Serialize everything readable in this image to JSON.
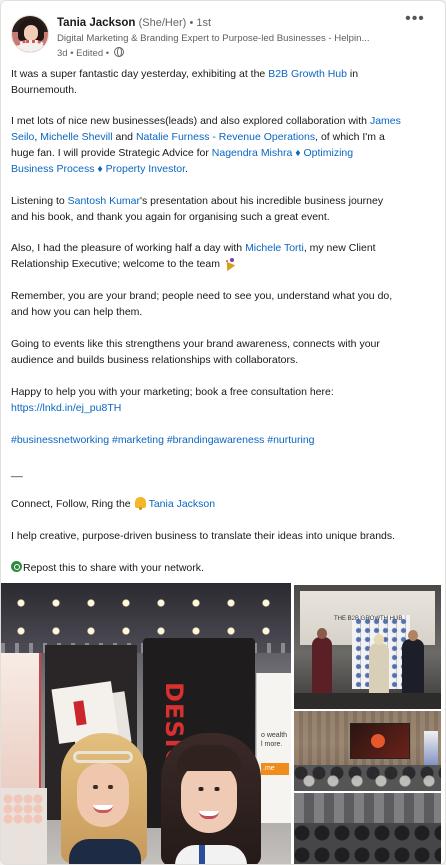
{
  "post": {
    "author": {
      "name": "Tania Jackson",
      "pronouns": "(She/Her)",
      "degree": "• 1st",
      "headline": "Digital Marketing & Branding Expert to Purpose-led Businesses - Helpin...",
      "meta": "3d • Edited •",
      "avatar_icon": "profile-photo"
    },
    "more_label": "•••",
    "lines": {
      "l1a": "It was a super fantastic day yesterday, exhibiting at the ",
      "l1b": "B2B Growth Hub",
      "l1c": " in",
      "l2": "Bournemouth.",
      "l3a": "I met lots of nice new businesses(leads) and also explored collaboration with ",
      "l3b": "James",
      "l4a": "Seilo",
      "l4b": ", ",
      "l4c": "Michelle Shevill",
      "l4d": " and ",
      "l4e": "Natalie Furness - Revenue Operations",
      "l4f": ", of which I'm a",
      "l5a": "huge fan. I will provide Strategic Advice for ",
      "l5b": "Nagendra Mishra ♦ Optimizing",
      "l6a": "Business Process ♦ Property Investor",
      "l6b": ".",
      "l7a": "Listening to ",
      "l7b": "Santosh Kumar",
      "l7c": "'s presentation about his incredible business journey",
      "l8": "and his book, and thank you again for organising such a great event.",
      "l9a": "Also, I had the pleasure of working half a day with ",
      "l9b": "Michele Torti",
      "l9c": ", my new Client",
      "l10": "Relationship Executive; welcome to the team ",
      "l11": "Remember, you are your brand; people need to see you, understand what you do,",
      "l12": "and how you can help them.",
      "l13": "Going to events like this strengthens your brand awareness, connects with your",
      "l14": "audience and builds business relationships with collaborators.",
      "l15": "Happy to help you with your marketing; book a free consultation here:",
      "l16": "https://lnkd.in/ej_pu8TH",
      "l17": "#businessnetworking #marketing #brandingawareness #nurturing",
      "l18": "__",
      "l19a": "Connect, Follow, Ring the ",
      "l19b": "Tania Jackson",
      "l20": "I help creative, purpose-driven business to translate their ideas into unique brands.",
      "l21": "Repost this to share with your network."
    },
    "photos": {
      "main_banner_text": "DESIGN",
      "side_board_text": "o wealth\nl more.",
      "side_board_tag": ".me",
      "top_right_title": "THE B2B GROWTH HUB"
    }
  }
}
